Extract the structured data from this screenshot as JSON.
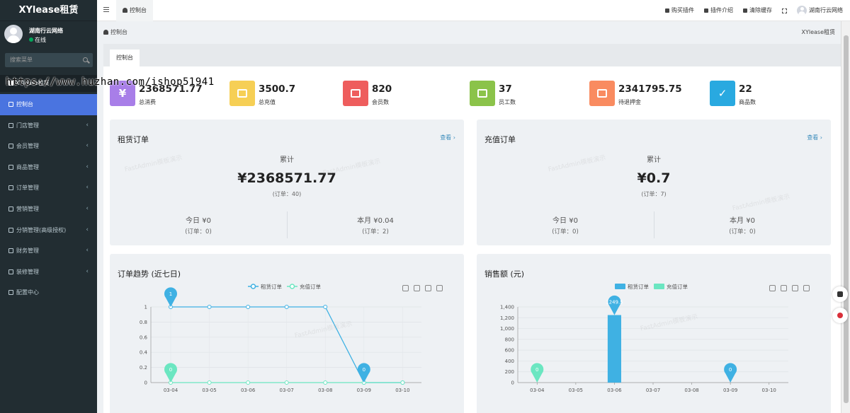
{
  "brand": "XYlease租赁",
  "user": {
    "name": "湖南行云网络",
    "status": "在线"
  },
  "search": {
    "placeholder": "搜索菜单"
  },
  "nav_header": "XYlease租赁",
  "url_overlay": "https://www.huzhan.com/ishop51941",
  "menu": [
    {
      "label": "控制台",
      "active": true,
      "icon": "dashboard-icon",
      "expandable": false
    },
    {
      "label": "门店管理",
      "active": false,
      "icon": "store-icon",
      "expandable": true
    },
    {
      "label": "会员管理",
      "active": false,
      "icon": "user-icon",
      "expandable": true
    },
    {
      "label": "商品管理",
      "active": false,
      "icon": "goods-icon",
      "expandable": true
    },
    {
      "label": "订单管理",
      "active": false,
      "icon": "order-icon",
      "expandable": true
    },
    {
      "label": "营销管理",
      "active": false,
      "icon": "marketing-icon",
      "expandable": true
    },
    {
      "label": "分销管理(高级授权)",
      "active": false,
      "icon": "distribution-icon",
      "expandable": true
    },
    {
      "label": "财务管理",
      "active": false,
      "icon": "finance-icon",
      "expandable": true
    },
    {
      "label": "装修管理",
      "active": false,
      "icon": "decorate-icon",
      "expandable": true
    },
    {
      "label": "配置中心",
      "active": false,
      "icon": "config-icon",
      "expandable": false
    }
  ],
  "topbar": {
    "tab": "控制台",
    "links": [
      "购买插件",
      "插件介绍",
      "清除缓存"
    ],
    "user": "湖南行云网络"
  },
  "breadcrumb": "控制台",
  "app_name": "XYlease租赁",
  "panel_tab": "控制台",
  "stats": [
    {
      "value": "2368571.77",
      "label": "总消费",
      "color": "#a87ee8",
      "icon": "yen-icon",
      "glyph": "¥"
    },
    {
      "value": "3500.7",
      "label": "总充值",
      "color": "#f6cf55",
      "icon": "box-icon",
      "glyph": ""
    },
    {
      "value": "820",
      "label": "会员数",
      "color": "#ee5d5d",
      "icon": "users-icon",
      "glyph": ""
    },
    {
      "value": "37",
      "label": "员工数",
      "color": "#8bc34a",
      "icon": "badge-icon",
      "glyph": ""
    },
    {
      "value": "2341795.75",
      "label": "待退押金",
      "color": "#f98b60",
      "icon": "grid-icon",
      "glyph": ""
    },
    {
      "value": "22",
      "label": "商品数",
      "color": "#29a9e0",
      "icon": "check-icon",
      "glyph": "✓"
    }
  ],
  "rental_orders": {
    "title": "租赁订单",
    "more": "查看 ›",
    "cumulative_label": "累计",
    "total": "¥2368571.77",
    "total_orders": "(订单：40)",
    "today": "今日 ¥0",
    "today_orders": "(订单：0)",
    "month": "本月 ¥0.04",
    "month_orders": "(订单：2)"
  },
  "recharge_orders": {
    "title": "充值订单",
    "more": "查看 ›",
    "cumulative_label": "累计",
    "total": "¥0.7",
    "total_orders": "(订单：7)",
    "today": "今日 ¥0",
    "today_orders": "(订单：0)",
    "month": "本月 ¥0",
    "month_orders": "(订单：0)"
  },
  "chart_data": [
    {
      "type": "line",
      "title": "订单趋势 (近七日)",
      "categories": [
        "03-04",
        "03-05",
        "03-06",
        "03-07",
        "03-08",
        "03-09",
        "03-10"
      ],
      "series": [
        {
          "name": "租赁订单",
          "values": [
            1,
            1,
            1,
            1,
            1,
            0,
            0
          ],
          "color": "#3fb1e3"
        },
        {
          "name": "充值订单",
          "values": [
            0,
            0,
            0,
            0,
            0,
            0,
            0
          ],
          "color": "#6be6c1"
        }
      ],
      "ylim": [
        0,
        1
      ],
      "yticks": [
        "0",
        "0.2",
        "0.4",
        "0.6",
        "0.8",
        "1"
      ],
      "markers": [
        {
          "series": 0,
          "index": 0,
          "label": "1"
        },
        {
          "series": 0,
          "index": 5,
          "label": "0"
        },
        {
          "series": 1,
          "index": 0,
          "label": "0"
        }
      ],
      "legend": "top-center"
    },
    {
      "type": "bar",
      "title": "销售额 (元)",
      "categories": [
        "03-04",
        "03-05",
        "03-06",
        "03-07",
        "03-08",
        "03-09",
        "03-10"
      ],
      "series": [
        {
          "name": "租赁订单",
          "values": [
            0,
            0,
            1249.5,
            0,
            0,
            0,
            0
          ],
          "color": "#3fb1e3"
        },
        {
          "name": "充值订单",
          "values": [
            0,
            0,
            0,
            0,
            0,
            0,
            0
          ],
          "color": "#6be6c1"
        }
      ],
      "ylim": [
        0,
        1400
      ],
      "yticks": [
        "0",
        "200",
        "400",
        "600",
        "800",
        "1,000",
        "1,200",
        "1,400"
      ],
      "markers": [
        {
          "series": 0,
          "index": 2,
          "label": "1249.5"
        },
        {
          "series": 0,
          "index": 5,
          "label": "0"
        },
        {
          "series": 1,
          "index": 0,
          "label": "0"
        }
      ],
      "legend": "top-center"
    }
  ],
  "watermark": "FastAdmin模板演示"
}
